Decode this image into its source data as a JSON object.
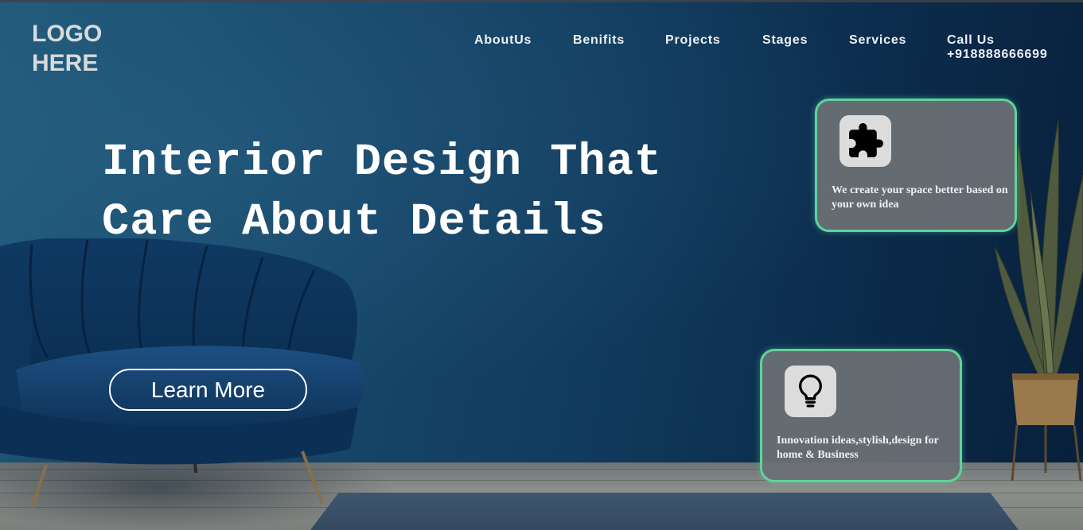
{
  "logo": {
    "line1": "LOGO",
    "line2": "HERE"
  },
  "nav": {
    "items": [
      "AboutUs",
      "Benifits",
      "Projects",
      "Stages",
      "Services"
    ],
    "call_label": "Call Us",
    "phone": "+918888666699"
  },
  "hero": {
    "headline_line1": "Interior Design That",
    "headline_line2": "Care About Details",
    "cta_label": "Learn More"
  },
  "cards": [
    {
      "icon": "puzzle-icon",
      "text": "We create your space better based on your own idea"
    },
    {
      "icon": "lightbulb-icon",
      "text": "Innovation ideas,stylish,design for home & Business"
    }
  ],
  "colors": {
    "card_border": "#5fd39a",
    "card_bg": "#6c7074",
    "wall": "#113b5d",
    "text": "#ffffff"
  }
}
